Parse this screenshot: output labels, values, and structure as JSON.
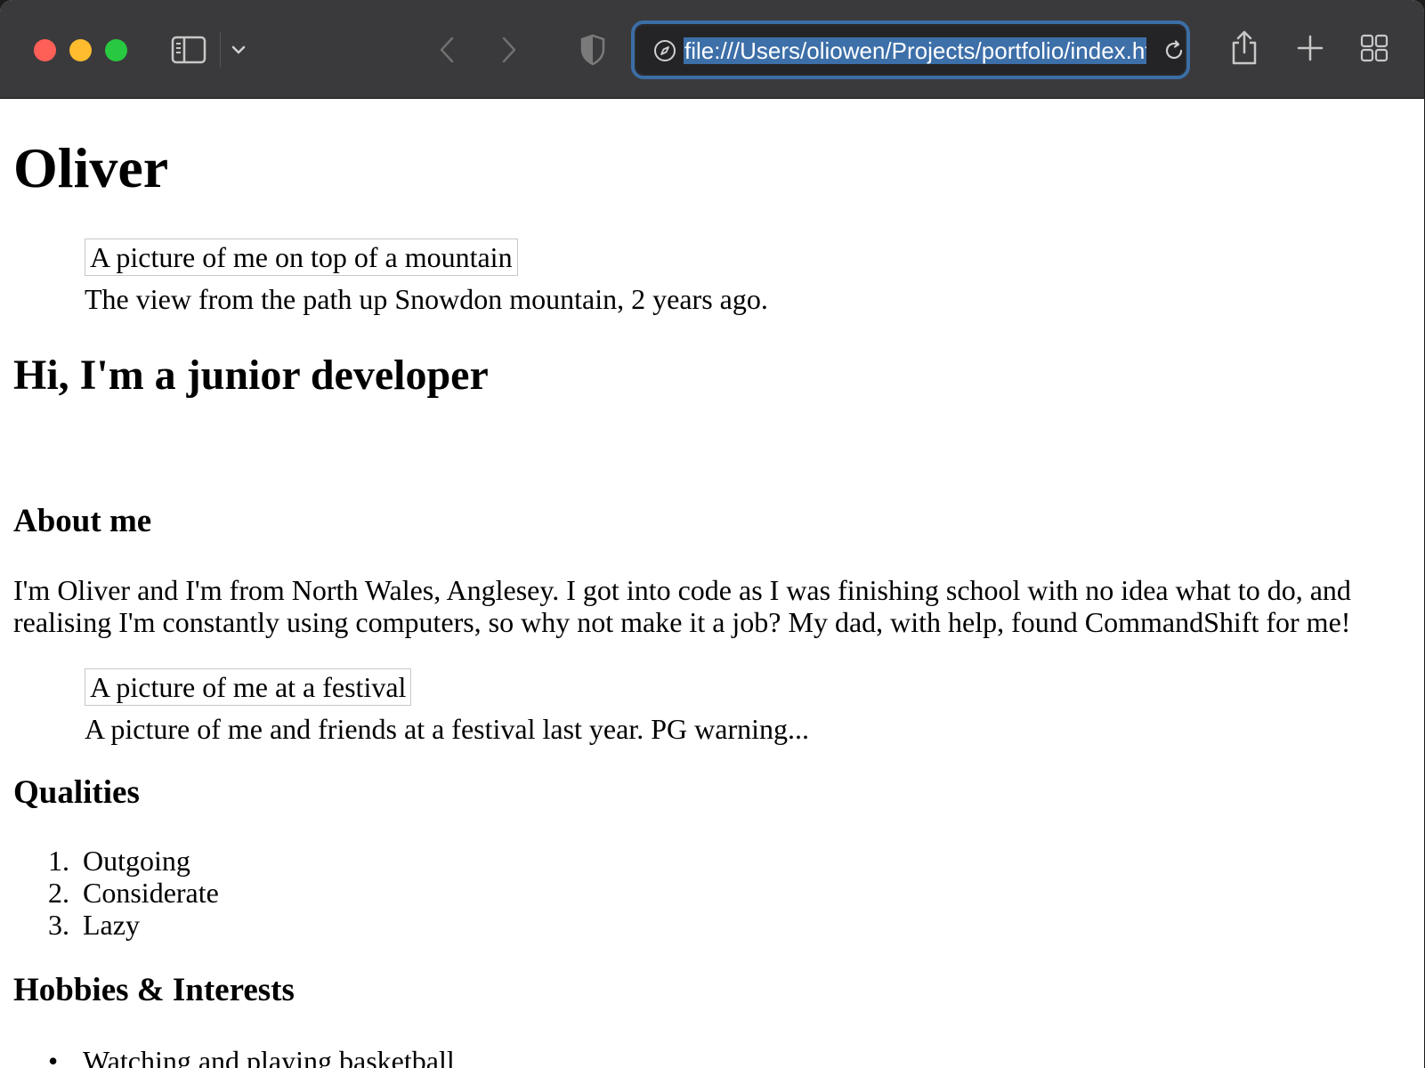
{
  "browser": {
    "url": "file:///Users/oliowen/Projects/portfolio/index.html",
    "icons": {
      "sidebar": "sidebar-icon",
      "chevron": "chevron-down-icon",
      "back": "back-arrow-icon",
      "forward": "forward-arrow-icon",
      "privacy": "shield-icon",
      "site": "compass-icon",
      "reload": "reload-icon",
      "share": "share-icon",
      "new_tab": "plus-icon",
      "tab_overview": "tab-grid-icon"
    },
    "colors": {
      "toolbar": "#3a3a3c",
      "url_focus_ring": "#3b6ea5",
      "url_selection": "#3d6fa8",
      "close": "#fe5f57",
      "minimize": "#febc2e",
      "maximize": "#28c840"
    }
  },
  "page": {
    "title": "Oliver",
    "figure1": {
      "alt": "A picture of me on top of a mountain",
      "caption": "The view from the path up Snowdon mountain, 2 years ago."
    },
    "tagline": "Hi, I'm a junior developer",
    "about": {
      "heading": "About me",
      "text": "I'm Oliver and I'm from North Wales, Anglesey. I got into code as I was finishing school with no idea what to do, and realising I'm constantly using computers, so why not make it a job? My dad, with help, found CommandShift for me!"
    },
    "figure2": {
      "alt": "A picture of me at a festival",
      "caption": "A picture of me and friends at a festival last year. PG warning..."
    },
    "qualities": {
      "heading": "Qualities",
      "items": [
        "Outgoing",
        "Considerate",
        "Lazy"
      ],
      "numbers": [
        "1.",
        "2.",
        "3."
      ]
    },
    "hobbies": {
      "heading": "Hobbies & Interests",
      "items": [
        "Watching and playing basketball"
      ],
      "bullet": "•"
    }
  }
}
